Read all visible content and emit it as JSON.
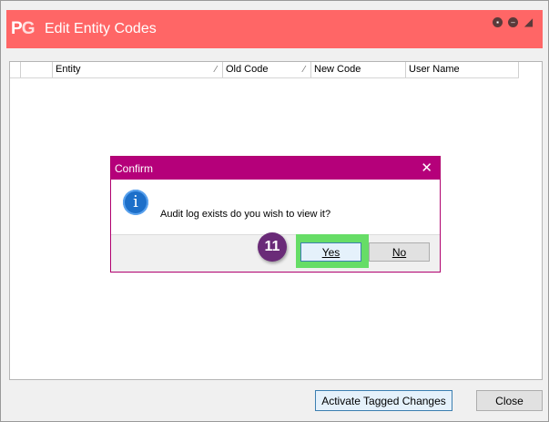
{
  "window": {
    "logo_p": "P",
    "logo_g": "G",
    "title": "Edit Entity Codes",
    "controls": {
      "restore": "▪",
      "minimize": "–",
      "extra": "◢"
    }
  },
  "grid": {
    "columns": [
      {
        "label": "",
        "sortable": false
      },
      {
        "label": "",
        "sortable": false
      },
      {
        "label": "Entity",
        "sortable": true
      },
      {
        "label": "Old Code",
        "sortable": true
      },
      {
        "label": "New Code",
        "sortable": false
      },
      {
        "label": "User Name",
        "sortable": false
      }
    ],
    "sort_glyph": "⁄",
    "rows": []
  },
  "dialog": {
    "title": "Confirm",
    "close_glyph": "✕",
    "info_glyph": "i",
    "message": "Audit log exists do you wish to view it?",
    "yes_label": "Yes",
    "no_label": "No"
  },
  "annotation": {
    "step": "11",
    "highlight_color": "#66dd66",
    "badge_color": "#6a2b78"
  },
  "footer": {
    "activate_label": "Activate Tagged Changes",
    "close_label": "Close"
  },
  "colors": {
    "titlebar": "#ff6666",
    "dialog_titlebar": "#b5007a",
    "info": "#1d6fc9"
  }
}
